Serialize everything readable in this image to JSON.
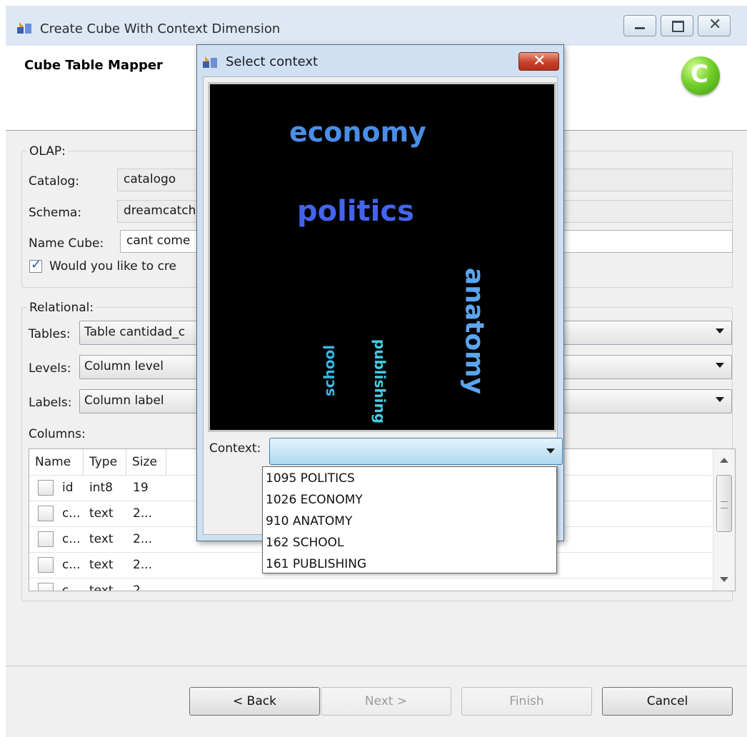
{
  "window": {
    "title": "Create Cube With Context Dimension",
    "page_title": "Cube Table Mapper"
  },
  "olap": {
    "group_label": "OLAP:",
    "catalog_label": "Catalog:",
    "catalog_value": "catalogo",
    "schema_label": "Schema:",
    "schema_value": "dreamcatch",
    "name_cube_label": "Name Cube:",
    "name_cube_value": "cant come",
    "checkbox_label": "Would you like to cre",
    "checkbox_checked": true
  },
  "relational": {
    "group_label": "Relational:",
    "tables_label": "Tables:",
    "tables_value": "Table cantidad_c",
    "levels_label": "Levels:",
    "levels_value": "Column level",
    "labels_label": "Labels:",
    "labels_value": "Column label",
    "columns_label": "Columns:",
    "columns_headers": [
      "Name",
      "Type",
      "Size"
    ],
    "rows": [
      {
        "name": "id",
        "type": "int8",
        "size": "19"
      },
      {
        "name": "c...",
        "type": "text",
        "size": "2..."
      },
      {
        "name": "c...",
        "type": "text",
        "size": "2..."
      },
      {
        "name": "c...",
        "type": "text",
        "size": "2..."
      },
      {
        "name": "c...",
        "type": "text",
        "size": "2..."
      }
    ]
  },
  "buttons": {
    "back": "< Back",
    "next": "Next >",
    "finish": "Finish",
    "cancel": "Cancel"
  },
  "dialog": {
    "title": "Select context",
    "close_symbol": "✕",
    "context_label": "Context:",
    "context_value": "",
    "word_cloud": [
      {
        "word": "economy",
        "color": "#4a8ee6"
      },
      {
        "word": "politics",
        "color": "#4464ee"
      },
      {
        "word": "anatomy",
        "color": "#5aa6f0"
      },
      {
        "word": "school",
        "color": "#39b8e6"
      },
      {
        "word": "publishing",
        "color": "#44cde3"
      }
    ],
    "options": [
      "1095 POLITICS",
      "1026 ECONOMY",
      "910 ANATOMY",
      "162 SCHOOL",
      "161 PUBLISHING"
    ]
  },
  "icons": {
    "app": "cube-app-icon",
    "logo": "green-c-logo-icon",
    "check_mark": "✓",
    "logo_letter": "C"
  }
}
